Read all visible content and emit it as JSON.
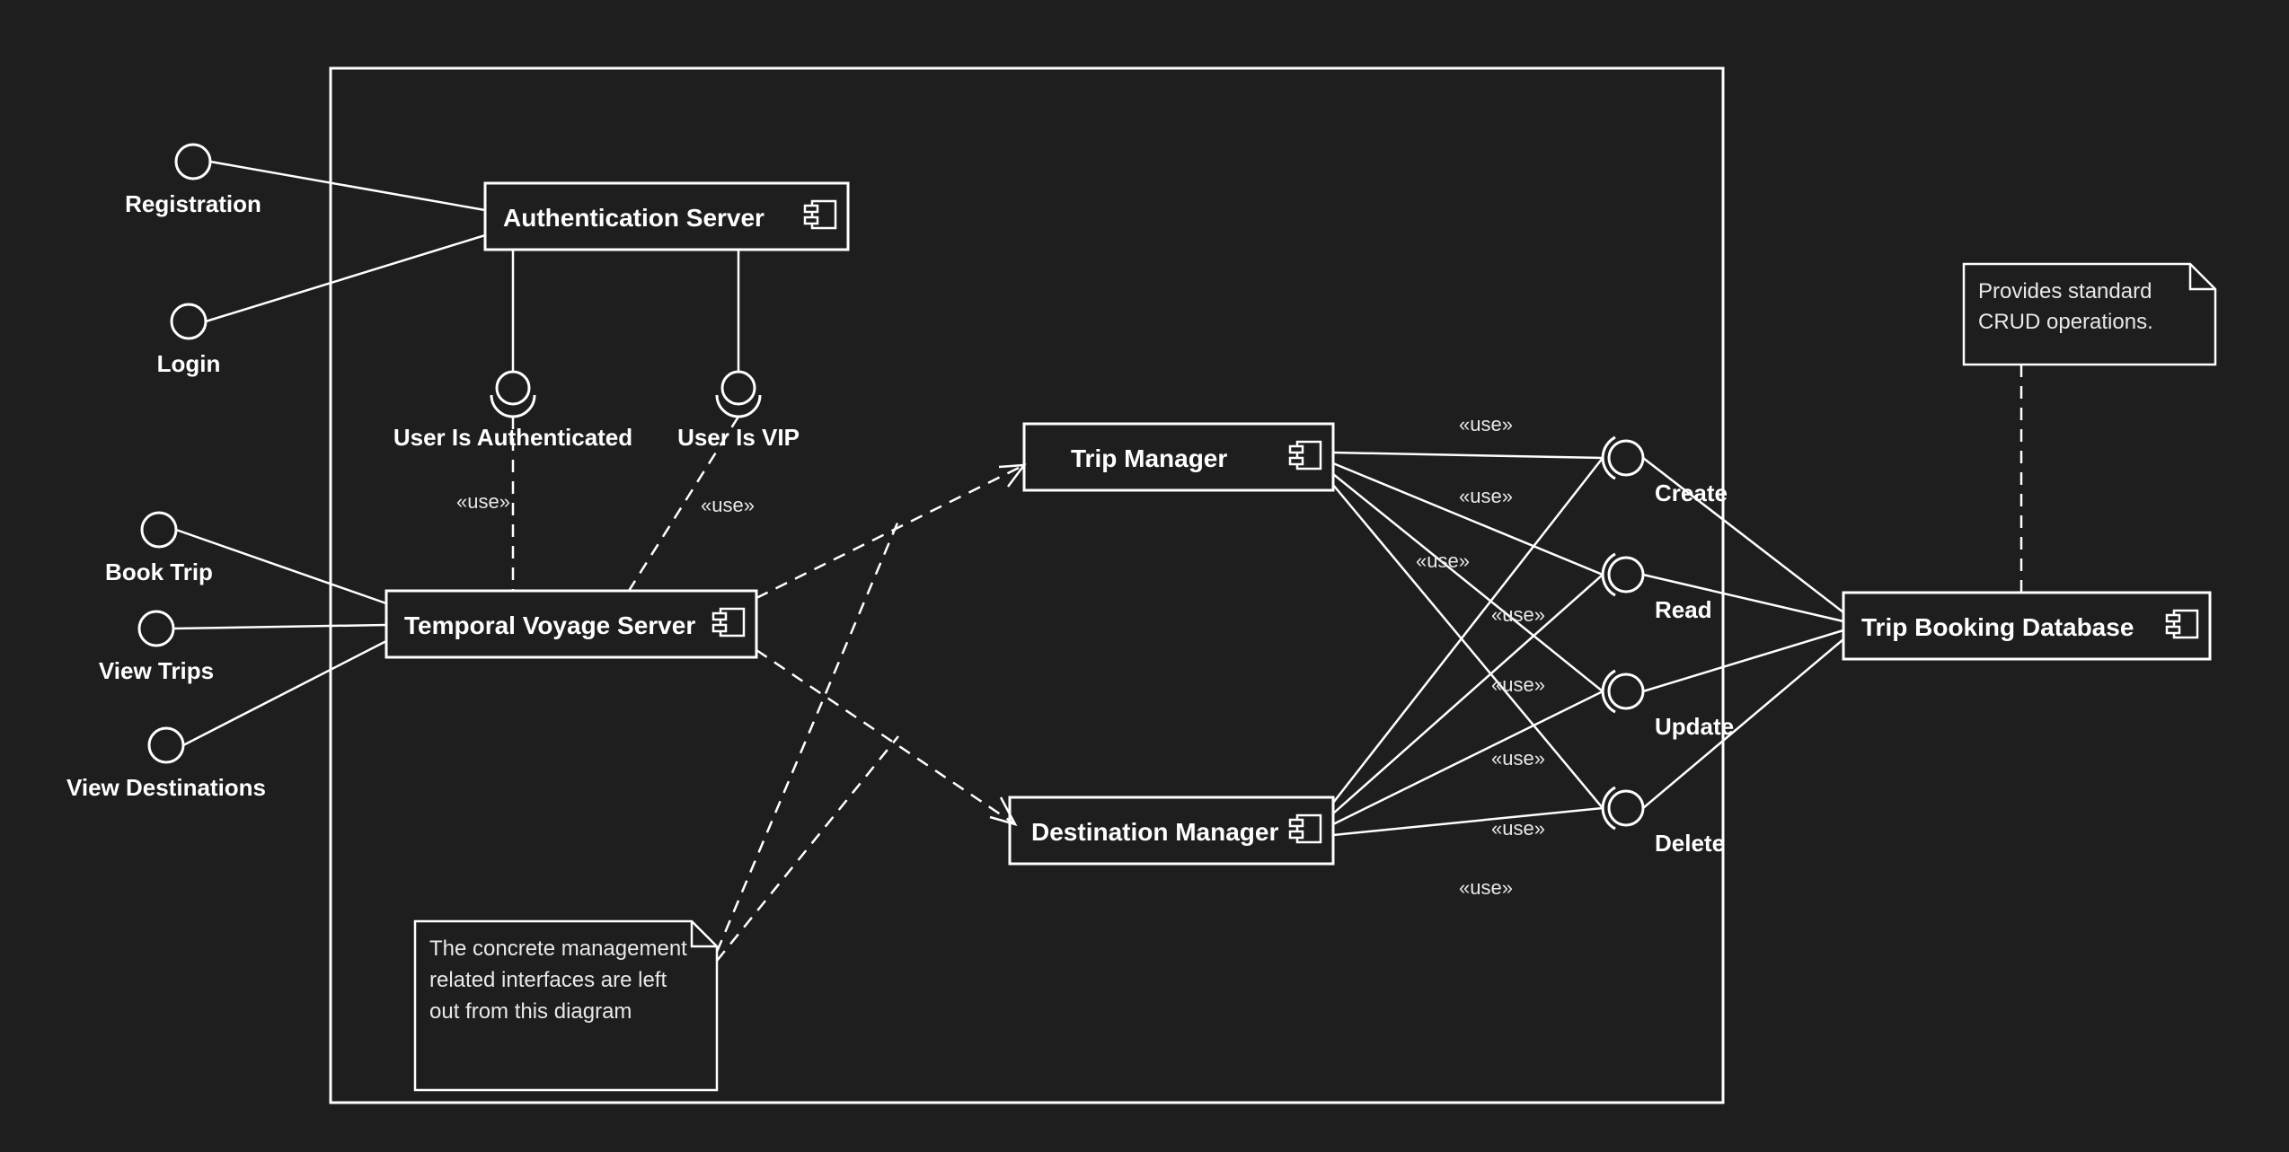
{
  "components": {
    "auth_server": "Authentication Server",
    "tvs": "Temporal Voyage Server",
    "trip_mgr": "Trip Manager",
    "dest_mgr": "Destination Manager",
    "db": "Trip Booking Database"
  },
  "interfaces": {
    "registration": "Registration",
    "login": "Login",
    "user_auth": "User Is Authenticated",
    "user_vip": "User Is VIP",
    "book_trip": "Book Trip",
    "view_trips": "View Trips",
    "view_dest": "View Destinations",
    "create": "Create",
    "read": "Read",
    "update": "Update",
    "delete": "Delete"
  },
  "stereotypes": {
    "use": "«use»"
  },
  "notes": {
    "mgmt_ifaces": "The concrete management related interfaces are left out from this diagram",
    "crud": "Provides standard CRUD operations."
  }
}
